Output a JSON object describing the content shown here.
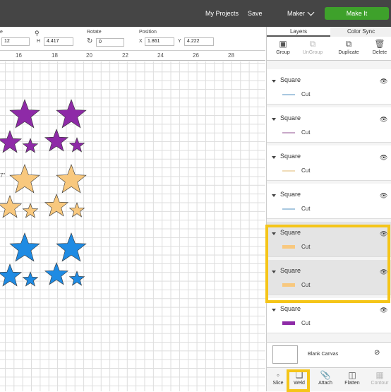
{
  "topbar": {
    "my_projects": "My Projects",
    "save": "Save",
    "separator": "|",
    "maker": "Maker",
    "make_it": "Make It"
  },
  "editbar": {
    "size_label_partial": "e",
    "font_size_value": "12",
    "h_label": "H",
    "h_value": "4.417",
    "rotate_label": "Rotate",
    "rotate_value": "0",
    "position_label": "Position",
    "x_label": "X",
    "x_value": "1.861",
    "y_label": "Y",
    "y_value": "4.222"
  },
  "ruler": [
    "16",
    "18",
    "20",
    "22",
    "24",
    "26",
    "28"
  ],
  "canvas": {
    "dimension_label": "7\"",
    "star_colors": {
      "purple": "#8e2aa7",
      "orange": "#f8c87e",
      "blue": "#1f8be3"
    }
  },
  "panel": {
    "tabs": [
      "Layers",
      "Color Sync"
    ],
    "tools": [
      {
        "label": "Group",
        "icon": "group-icon",
        "enabled": true
      },
      {
        "label": "UnGroup",
        "icon": "ungroup-icon",
        "enabled": false
      },
      {
        "label": "Duplicate",
        "icon": "duplicate-icon",
        "enabled": true
      },
      {
        "label": "Delete",
        "icon": "trash-icon",
        "enabled": true
      }
    ],
    "layers": [
      {
        "name": "Square",
        "op": "Cut",
        "color": "#a8c8e0",
        "selected": false
      },
      {
        "name": "Square",
        "op": "Cut",
        "color": "#c8a8c8",
        "selected": false
      },
      {
        "name": "Square",
        "op": "Cut",
        "color": "#f0dcb8",
        "selected": false
      },
      {
        "name": "Square",
        "op": "Cut",
        "color": "#a8c8e0",
        "selected": false
      },
      {
        "name": "Square",
        "op": "Cut",
        "color": "#f8c87e",
        "selected": true
      },
      {
        "name": "Square",
        "op": "Cut",
        "color": "#f8c87e",
        "selected": true
      },
      {
        "name": "Square",
        "op": "Cut",
        "color": "#8e2aa7",
        "selected": false
      }
    ],
    "blank_canvas": "Blank Canvas",
    "bottom_tools": [
      {
        "label": "Slice",
        "icon": "slice-icon",
        "enabled": true
      },
      {
        "label": "Weld",
        "icon": "weld-icon",
        "enabled": true
      },
      {
        "label": "Attach",
        "icon": "attach-icon",
        "enabled": true
      },
      {
        "label": "Flatten",
        "icon": "flatten-icon",
        "enabled": true
      },
      {
        "label": "Contour",
        "icon": "contour-icon",
        "enabled": false
      }
    ],
    "highlight_color": "#f5c518"
  }
}
